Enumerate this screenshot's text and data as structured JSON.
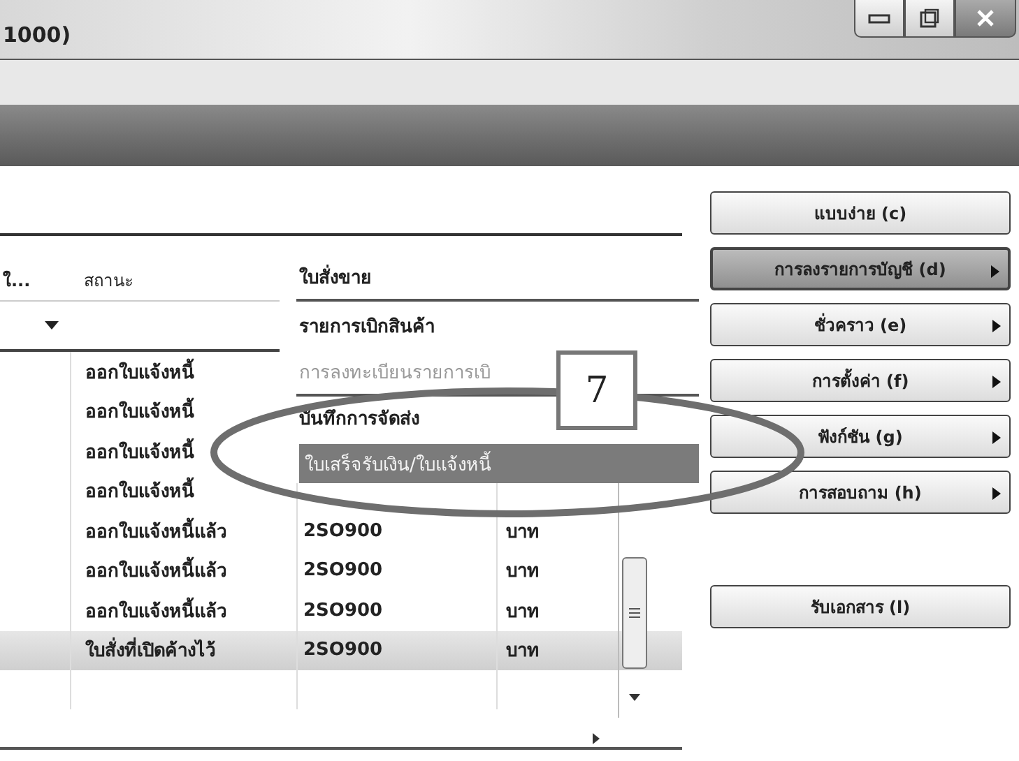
{
  "window": {
    "title": "1000)"
  },
  "table": {
    "columns": [
      "ใ...",
      "สถานะ"
    ],
    "rows": [
      {
        "status": "ออกใบแจ้งหนี้",
        "selected": false
      },
      {
        "status": "ออกใบแจ้งหนี้",
        "selected": false
      },
      {
        "status": "ออกใบแจ้งหนี้",
        "selected": false
      },
      {
        "status": "ออกใบแจ้งหนี้",
        "selected": false
      },
      {
        "status": "ออกใบแจ้งหนี้แล้ว",
        "document": "2SO900",
        "currency": "บาท",
        "selected": false
      },
      {
        "status": "ออกใบแจ้งหนี้แล้ว",
        "document": "2SO900",
        "currency": "บาท",
        "selected": false
      },
      {
        "status": "ออกใบแจ้งหนี้แล้ว",
        "document": "2SO900",
        "currency": "บาท",
        "selected": false
      },
      {
        "status": "ใบสั่งที่เปิดค้างไว้",
        "document": "2SO900",
        "currency": "บาท",
        "selected": true
      }
    ]
  },
  "context_menu": {
    "items": [
      {
        "label": "ใบสั่งขาย",
        "disabled": false,
        "selected": false
      },
      {
        "label": "รายการเบิกสินค้า",
        "disabled": false,
        "selected": false
      },
      {
        "label": "การลงทะเบียนรายการเบิ",
        "disabled": true,
        "selected": false
      },
      {
        "label": "บันทึกการจัดส่ง",
        "disabled": false,
        "selected": false
      },
      {
        "label": "ใบเสร็จรับเงิน/ใบแจ้งหนี้",
        "disabled": false,
        "selected": true
      }
    ]
  },
  "buttons": [
    {
      "label": "แบบง่าย (c)",
      "selected": false,
      "submenu": false
    },
    {
      "label": "การลงรายการบัญชี (d)",
      "selected": true,
      "submenu": true
    },
    {
      "label": "ชั่วคราว (e)",
      "selected": false,
      "submenu": true
    },
    {
      "label": "การตั้งค่า (f)",
      "selected": false,
      "submenu": true
    },
    {
      "label": "ฟังก์ชัน (g)",
      "selected": false,
      "submenu": true
    },
    {
      "label": "การสอบถาม (h)",
      "selected": false,
      "submenu": true
    }
  ],
  "receive_button": {
    "label": "รับเอกสาร (l)"
  },
  "callout": {
    "number": "7"
  }
}
